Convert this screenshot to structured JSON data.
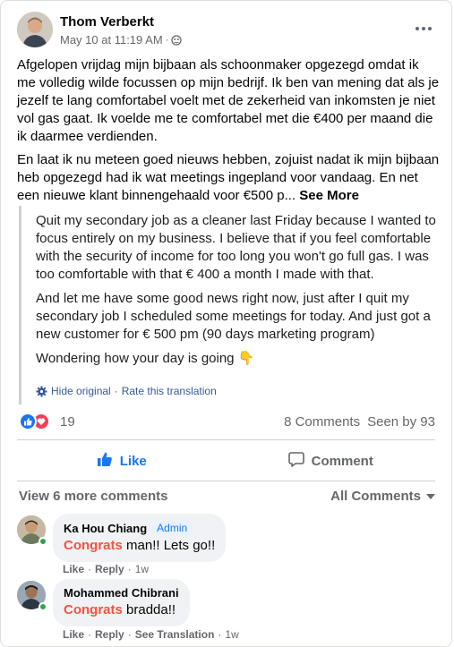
{
  "post": {
    "author": "Thom Verberkt",
    "timestamp": "May 10 at 11:19 AM",
    "separator": "·",
    "privacy_icon": "group-icon",
    "paragraphs": [
      "Afgelopen vrijdag mijn bijbaan als schoonmaker opgezegd omdat ik me volledig wilde focussen op mijn bedrijf. Ik ben van mening dat als je jezelf te lang comfortabel voelt met de zekerheid van inkomsten je niet vol gas gaat. Ik voelde me te comfortabel met die €400 per maand die ik daarmee verdienden.",
      "En laat ik nu meteen goed nieuws hebben, zojuist nadat ik mijn bijbaan heb opgezegd had ik wat meetings ingepland voor vandaag. En net een nieuwe klant binnengehaald voor €500 p..."
    ],
    "see_more": "See More"
  },
  "translation": {
    "paragraphs": [
      "Quit my secondary job as a cleaner last Friday because I wanted to focus entirely on my business. I believe that if you feel comfortable with the security of income for too long you won't go full gas. I was too comfortable with that € 400 a month I made with that.",
      "And let me have some good news right now, just after I quit my secondary job I scheduled some meetings for today. And just got a new customer for € 500 pm (90 days marketing program)",
      "Wondering how your day is going 👇"
    ],
    "hide_original": "Hide original",
    "separator": "·",
    "rate": "Rate this translation"
  },
  "stats": {
    "reaction_count": "19",
    "comments": "8 Comments",
    "seen_by": "Seen by 93"
  },
  "actions": {
    "like": "Like",
    "comment": "Comment"
  },
  "comments_section": {
    "view_more": "View 6 more comments",
    "filter": "All Comments",
    "comments": [
      {
        "name": "Ka Hou Chiang",
        "badge": "Admin",
        "highlight": "Congrats",
        "text": " man!! Lets go!!",
        "like": "Like",
        "reply": "Reply",
        "time": "1w",
        "sep": "·"
      },
      {
        "name": "Mohammed Chibrani",
        "highlight": "Congrats",
        "text": " bradda!!",
        "like": "Like",
        "reply": "Reply",
        "see_translation": "See Translation",
        "time": "1w",
        "sep": "·"
      }
    ]
  },
  "colors": {
    "accent": "#1877f2",
    "link": "#385898",
    "highlight": "#f5533d",
    "online": "#31a24c"
  }
}
